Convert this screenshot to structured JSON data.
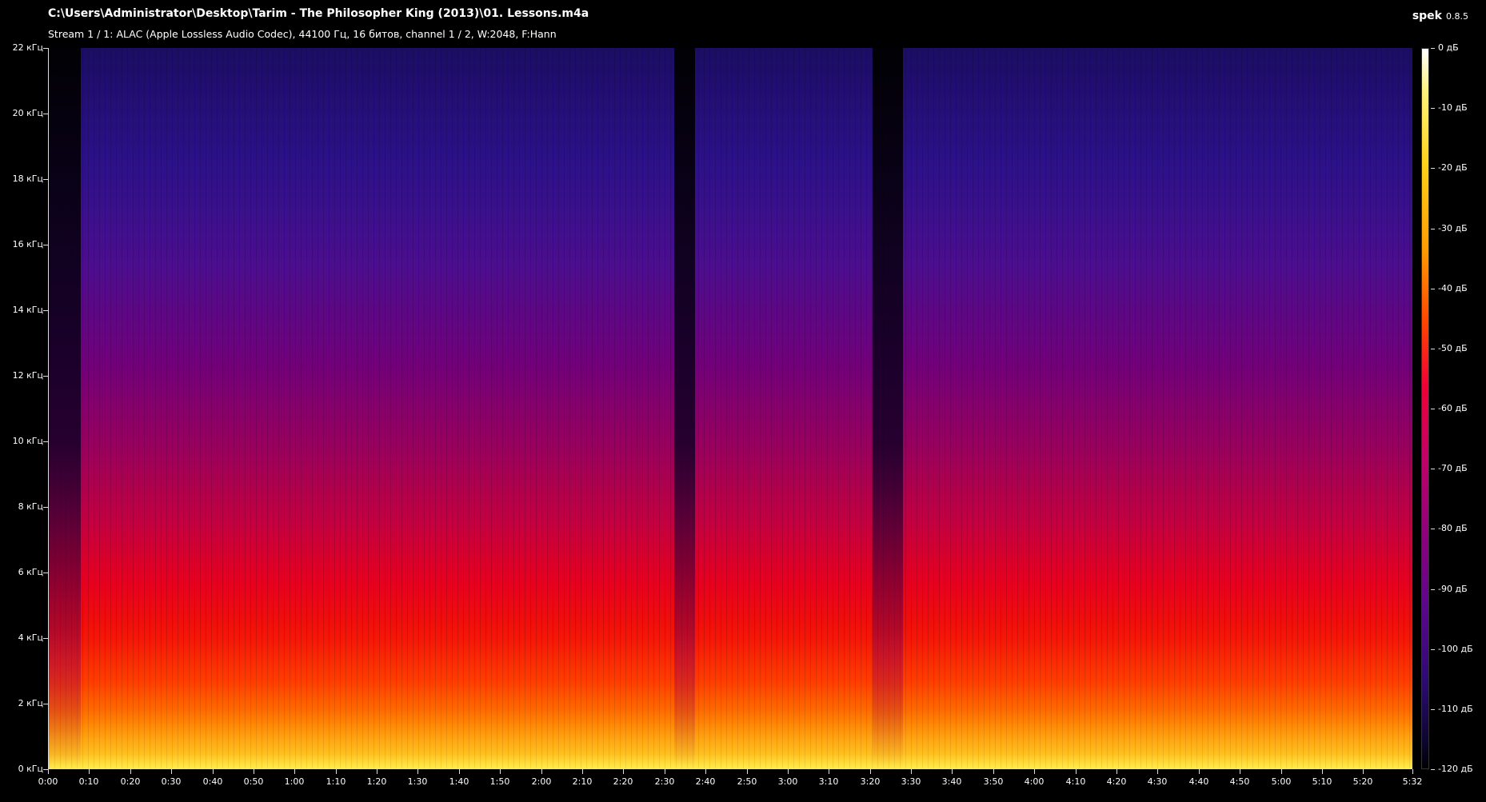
{
  "header": {
    "file_path": "C:\\Users\\Administrator\\Desktop\\Tarim - The Philosopher King (2013)\\01. Lessons.m4a",
    "stream_info": "Stream 1 / 1: ALAC (Apple Lossless Audio Codec), 44100 Гц, 16 битов, channel 1 / 2, W:2048, F:Hann",
    "app_name": "spek",
    "app_version": "0.8.5"
  },
  "axes": {
    "frequency_labels": [
      "22 кГц",
      "20 кГц",
      "18 кГц",
      "16 кГц",
      "14 кГц",
      "12 кГц",
      "10 кГц",
      "8 кГц",
      "6 кГц",
      "4 кГц",
      "2 кГц",
      "0 кГц"
    ],
    "time_labels": [
      "0:00",
      "0:10",
      "0:20",
      "0:30",
      "0:40",
      "0:50",
      "1:00",
      "1:10",
      "1:20",
      "1:30",
      "1:40",
      "1:50",
      "2:00",
      "2:10",
      "2:20",
      "2:30",
      "2:40",
      "2:50",
      "3:00",
      "3:10",
      "3:20",
      "3:30",
      "3:40",
      "3:50",
      "4:00",
      "4:10",
      "4:20",
      "4:30",
      "4:40",
      "4:50",
      "5:00",
      "5:10",
      "5:20",
      "5:32"
    ],
    "db_labels": [
      "0 дБ",
      "-10 дБ",
      "-20 дБ",
      "-30 дБ",
      "-40 дБ",
      "-50 дБ",
      "-60 дБ",
      "-70 дБ",
      "-80 дБ",
      "-90 дБ",
      "-100 дБ",
      "-110 дБ",
      "-120 дБ"
    ]
  },
  "colors": {
    "background": "#000000",
    "axis": "#dddddd",
    "text": "#ffffff"
  }
}
